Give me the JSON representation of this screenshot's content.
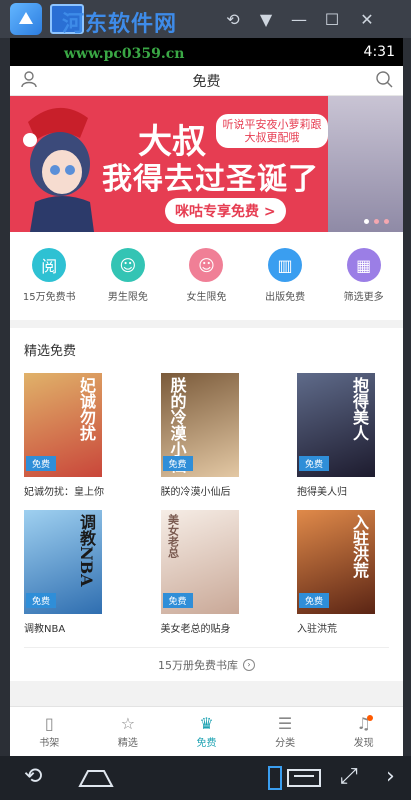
{
  "emulator": {
    "watermark": "河东软件网",
    "url": "www.pc0359.cn"
  },
  "status": {
    "time": "4:31"
  },
  "topbar": {
    "title": "免费"
  },
  "banner": {
    "line1": "大叔",
    "line2": "我得去过圣诞了",
    "note": "听说平安夜小萝莉跟大叔更配哦",
    "button": "咪咕专享免费 >"
  },
  "categories": [
    {
      "label": "15万免费书",
      "icon": "book-icon",
      "glyph": "阅",
      "color": "#2ec1d3"
    },
    {
      "label": "男生限免",
      "icon": "boy-icon",
      "glyph": "☺",
      "color": "#33c4b4"
    },
    {
      "label": "女生限免",
      "icon": "girl-icon",
      "glyph": "☺",
      "color": "#f07f96"
    },
    {
      "label": "出版免费",
      "icon": "books-icon",
      "glyph": "▥",
      "color": "#3a9ef0"
    },
    {
      "label": "筛选更多",
      "icon": "grid-icon",
      "glyph": "▦",
      "color": "#9b7ee6"
    }
  ],
  "section": {
    "title": "精选免费",
    "badge": "免费",
    "books": [
      {
        "name": "妃诚勿扰：皇上你",
        "cover_text": "妃诚勿扰",
        "bg": "#c9463a"
      },
      {
        "name": "朕的冷漠小仙后",
        "cover_text": "朕的冷漠小仙",
        "bg": "#c8a27a"
      },
      {
        "name": "抱得美人归",
        "cover_text": "抱得美人",
        "bg": "#2d2a46"
      },
      {
        "name": "调教NBA",
        "cover_text": "调教NBA",
        "bg": "#3c7fc6"
      },
      {
        "name": "美女老总的贴身",
        "cover_text": "美女老总",
        "bg": "#e8d6cf"
      },
      {
        "name": "入驻洪荒",
        "cover_text": "入驻洪荒",
        "bg": "#b8562c"
      }
    ],
    "more": "15万册免费书库"
  },
  "tabs": [
    {
      "label": "书架",
      "icon": "bookshelf-icon",
      "glyph": "▯"
    },
    {
      "label": "精选",
      "icon": "star-icon",
      "glyph": "☆"
    },
    {
      "label": "免费",
      "icon": "crown-icon",
      "glyph": "♛",
      "active": true
    },
    {
      "label": "分类",
      "icon": "category-icon",
      "glyph": "☰"
    },
    {
      "label": "发现",
      "icon": "bell-icon",
      "glyph": "♫",
      "dot": true
    }
  ],
  "colors": {
    "accent": "#1fa3b3",
    "banner": "#e63d52"
  }
}
